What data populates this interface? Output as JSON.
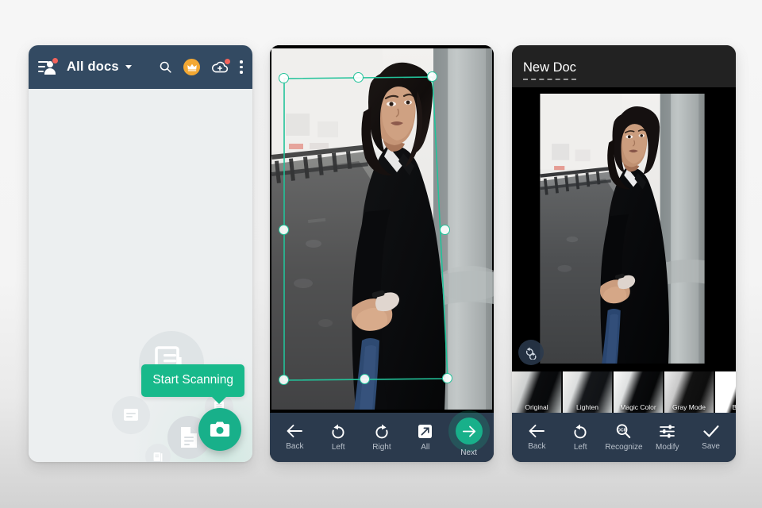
{
  "panel1": {
    "name": "documents-list-screen",
    "header": {
      "account_icon": "account-list-icon",
      "title": "All docs",
      "caret": "chevron-down-icon",
      "search_icon": "search-icon",
      "premium_icon": "crown-icon",
      "cloud_icon": "cloud-upload-icon",
      "menu_icon": "overflow-menu-icon"
    },
    "empty_state": {
      "illustration": "documents-bubbles-illustration"
    },
    "tooltip": "Start Scanning",
    "fab": {
      "label": "camera-fab",
      "icon": "camera-icon"
    }
  },
  "panel2": {
    "name": "crop-edit-screen",
    "crop": {
      "overlay": "crop-quad-overlay",
      "handle_count": 8,
      "accent": "#22c39a"
    },
    "toolbar": [
      {
        "label": "Back",
        "icon": "arrow-left-icon"
      },
      {
        "label": "Left",
        "icon": "rotate-left-icon"
      },
      {
        "label": "Right",
        "icon": "rotate-right-icon"
      },
      {
        "label": "All",
        "icon": "select-all-icon"
      },
      {
        "label": "Next",
        "icon": "arrow-right-icon"
      }
    ]
  },
  "panel3": {
    "name": "filter-preview-screen",
    "header": {
      "doc_title": "New Doc"
    },
    "rotate_button": "rotate-both-icon",
    "filters": [
      {
        "label": "Original",
        "selected": false
      },
      {
        "label": "Lighten",
        "selected": false
      },
      {
        "label": "Magic Color",
        "selected": true
      },
      {
        "label": "Gray Mode",
        "selected": false
      },
      {
        "label": "B&W",
        "selected": false
      }
    ],
    "toolbar": [
      {
        "label": "Back",
        "icon": "arrow-left-icon"
      },
      {
        "label": "Left",
        "icon": "rotate-left-icon"
      },
      {
        "label": "Recognize",
        "icon": "ocr-search-icon"
      },
      {
        "label": "Modify",
        "icon": "sliders-icon"
      },
      {
        "label": "Save",
        "icon": "check-icon"
      }
    ]
  },
  "colors": {
    "header_navy": "#334a62",
    "toolbar_navy": "#2b3a4d",
    "accent_green": "#18b08a",
    "crop_teal": "#22c39a",
    "badge_red": "#f4635b",
    "crown_orange": "#f3a833"
  }
}
